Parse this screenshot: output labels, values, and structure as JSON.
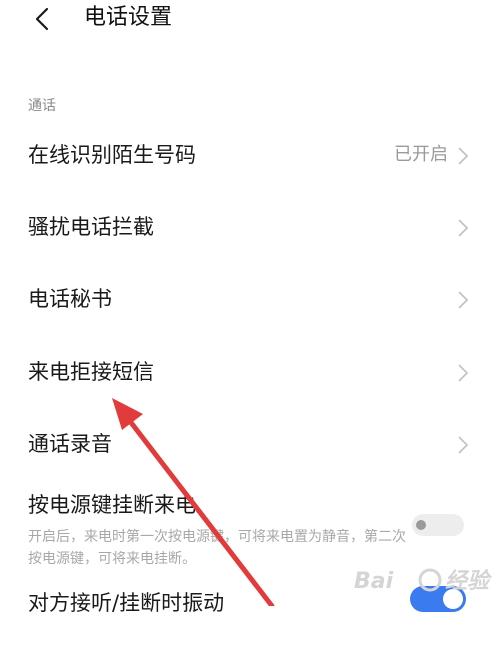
{
  "header": {
    "title": "电话设置",
    "back_icon": "chevron-left-icon"
  },
  "section": {
    "label": "通话"
  },
  "items": [
    {
      "label": "在线识别陌生号码",
      "value": "已开启"
    },
    {
      "label": "骚扰电话拦截"
    },
    {
      "label": "电话秘书"
    },
    {
      "label": "来电拒接短信"
    },
    {
      "label": "通话录音"
    }
  ],
  "power_key": {
    "label": "按电源键挂断来电",
    "description": "开启后，来电时第一次按电源键，可将来电置为静音，第二次按电源键，可将来电挂断。",
    "enabled": false
  },
  "vibrate": {
    "label": "对方接听/挂断时振动",
    "enabled": true
  },
  "annotation": {
    "color": "#e23b3b"
  },
  "watermark": {
    "text": "Bai",
    "text2": "经验"
  },
  "colors": {
    "toggle_on": "#3a7bf0",
    "secondary_text": "#9a9a9a"
  }
}
